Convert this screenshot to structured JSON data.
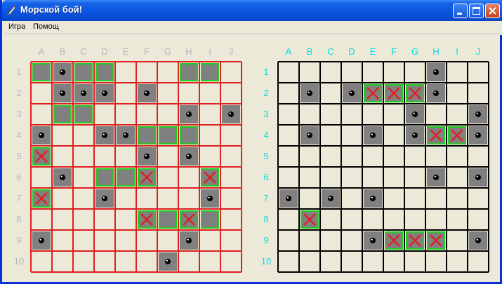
{
  "window": {
    "title": "Морской бой!"
  },
  "menu": {
    "items": [
      "Игра",
      "Помощ"
    ]
  },
  "columns": [
    "A",
    "B",
    "C",
    "D",
    "E",
    "F",
    "G",
    "H",
    "I",
    "J"
  ],
  "rows": [
    "1",
    "2",
    "3",
    "4",
    "5",
    "6",
    "7",
    "8",
    "9",
    "10"
  ],
  "colors": {
    "player_grid_lines": "#E02020",
    "player_labels": "#B8B8B8",
    "enemy_grid_lines": "#000000",
    "enemy_labels": "#00E0E0",
    "ship_fill": "#808080",
    "ship_outline": "#22CC22",
    "hit_cross": "#E02020"
  },
  "player_board": {
    "ships": [
      "A1",
      "C1",
      "D1",
      "H1",
      "I1",
      "B3",
      "C3",
      "F4",
      "G4",
      "H4",
      "D6",
      "E6",
      "G8",
      "I8"
    ],
    "hits": [
      "A5",
      "F6",
      "I6",
      "A7",
      "F8",
      "H8"
    ],
    "misses": [
      "B1",
      "B2",
      "C2",
      "D2",
      "F2",
      "H3",
      "J3",
      "A4",
      "D4",
      "E4",
      "F5",
      "H5",
      "B6",
      "D7",
      "I7",
      "A9",
      "H9",
      "G10"
    ]
  },
  "enemy_board": {
    "ships": [],
    "hits": [
      "E2",
      "F2",
      "G2",
      "H4",
      "I4",
      "B8",
      "F9",
      "G9",
      "H9"
    ],
    "misses": [
      "H1",
      "B2",
      "D2",
      "H2",
      "G3",
      "J3",
      "B4",
      "E4",
      "G4",
      "J4",
      "H6",
      "J6",
      "A7",
      "C7",
      "E7",
      "E9",
      "J9"
    ]
  }
}
